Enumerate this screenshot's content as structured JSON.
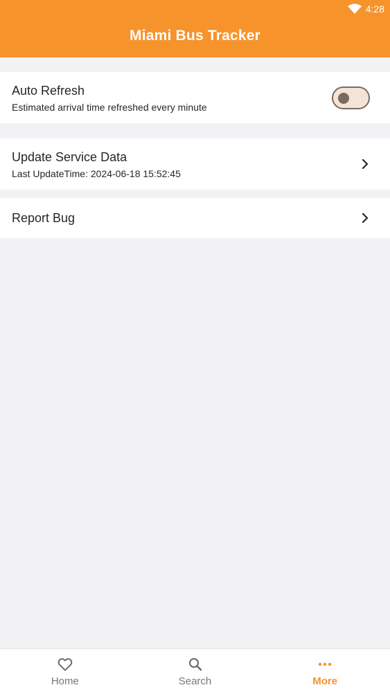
{
  "status_bar": {
    "time": "4:28"
  },
  "app_bar": {
    "title": "Miami Bus Tracker"
  },
  "settings": {
    "auto_refresh": {
      "title": "Auto Refresh",
      "subtitle": "Estimated arrival time refreshed every minute",
      "enabled": false
    },
    "update_service": {
      "title": "Update Service Data",
      "subtitle": "Last UpdateTime: 2024-06-18 15:52:45"
    },
    "report_bug": {
      "title": "Report Bug"
    }
  },
  "bottom_nav": {
    "items": [
      {
        "label": "Home",
        "icon": "heart-icon"
      },
      {
        "label": "Search",
        "icon": "search-icon"
      },
      {
        "label": "More",
        "icon": "more-dots-icon",
        "active": true
      }
    ]
  },
  "colors": {
    "accent": "#f7932b",
    "toggle_border": "#7a6a5e",
    "toggle_track": "#f5e3d6"
  }
}
